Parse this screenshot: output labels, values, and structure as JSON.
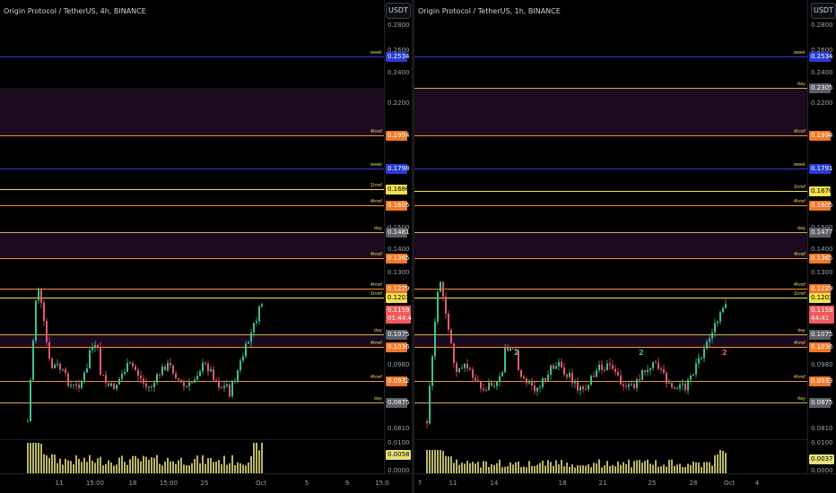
{
  "colors": {
    "background": "#000000",
    "zone": "#1c0a1e",
    "week": "#2a3bd6",
    "day": "#c9b24a",
    "fourh": "#f0922a",
    "oneh": "#f2e14a",
    "current": "#f05a5a",
    "candle_up": "#3fbf8f",
    "candle_down": "#e05a6e",
    "volume": "#d9d77a"
  },
  "panels": [
    {
      "id": "left",
      "title": "Origin Protocol / TetherUS, 4h, BINANCE",
      "currency_button": "USDT",
      "price_ticks": [
        "0.2800",
        "0.2600",
        "0.2400",
        "0.2200",
        "0.1500",
        "0.1400",
        "0.1300",
        "0.0980",
        "0.0810",
        "0.0100",
        "0.0000"
      ],
      "time_ticks": [
        "11",
        "15:00",
        "18",
        "15:00",
        "25",
        "Oct",
        "5",
        "9",
        "15:0"
      ],
      "levels": [
        {
          "label": "week",
          "tag": "0.2534",
          "kind": "week"
        },
        {
          "label": "4href",
          "tag": "0.1994",
          "kind": "fourh"
        },
        {
          "label": "week",
          "tag": "0.1798",
          "kind": "week"
        },
        {
          "label": "1href",
          "tag": "0.1686",
          "kind": "oneh"
        },
        {
          "label": "4href",
          "tag": "0.1605",
          "kind": "fourh"
        },
        {
          "label": "day",
          "tag": "0.1481",
          "kind": "day"
        },
        {
          "label": "4href",
          "tag": "0.1365",
          "kind": "fourh"
        },
        {
          "label": "4href",
          "tag": "0.1229",
          "kind": "fourh"
        },
        {
          "label": "1href",
          "tag": "0.1203",
          "kind": "oneh"
        },
        {
          "label": "day",
          "tag": "0.1075",
          "kind": "day"
        },
        {
          "label": "4href",
          "tag": "0.1036",
          "kind": "fourh"
        },
        {
          "label": "4href",
          "tag": "0.0932",
          "kind": "fourh"
        },
        {
          "label": "day",
          "tag": "0.0875",
          "kind": "day"
        }
      ],
      "current_price": "0.1159",
      "countdown": "01:44:41",
      "volume_value": "0.0058",
      "markers": []
    },
    {
      "id": "right",
      "title": "Origin Protocol / TetherUS, 1h, BINANCE",
      "currency_button": "USDT",
      "price_ticks": [
        "0.2800",
        "0.2600",
        "0.2400",
        "0.2200",
        "0.1500",
        "0.1400",
        "0.1300",
        "0.0980",
        "0.0810",
        "0.0100",
        "0.0000"
      ],
      "time_ticks": [
        "7",
        "11",
        "14",
        "18",
        "21",
        "25",
        "28",
        "Oct",
        "4"
      ],
      "levels": [
        {
          "label": "week",
          "tag": "0.2534",
          "kind": "week"
        },
        {
          "label": "day",
          "tag": "0.2305",
          "kind": "day"
        },
        {
          "label": "4href",
          "tag": "0.1994",
          "kind": "fourh"
        },
        {
          "label": "week",
          "tag": "0.1791",
          "kind": "week"
        },
        {
          "label": "1href",
          "tag": "0.1676",
          "kind": "oneh"
        },
        {
          "label": "4href",
          "tag": "0.1605",
          "kind": "fourh"
        },
        {
          "label": "day",
          "tag": "0.1477",
          "kind": "day"
        },
        {
          "label": "4href",
          "tag": "0.1365",
          "kind": "fourh"
        },
        {
          "label": "4href",
          "tag": "0.1229",
          "kind": "fourh"
        },
        {
          "label": "1href",
          "tag": "0.1203",
          "kind": "oneh"
        },
        {
          "label": "day",
          "tag": "0.1075",
          "kind": "day"
        },
        {
          "label": "4href",
          "tag": "0.1036",
          "kind": "fourh"
        },
        {
          "label": "4href",
          "tag": "0.0933",
          "kind": "fourh"
        },
        {
          "label": "day",
          "tag": "0.0875",
          "kind": "day"
        }
      ],
      "current_price": "0.1159",
      "countdown": "44:41",
      "volume_value": "0.0037",
      "markers": [
        {
          "text": "2",
          "color": "#3fbf8f"
        },
        {
          "text": "2",
          "color": "#3fbf8f"
        },
        {
          "text": "2",
          "color": "#f05a7a"
        }
      ]
    }
  ]
}
